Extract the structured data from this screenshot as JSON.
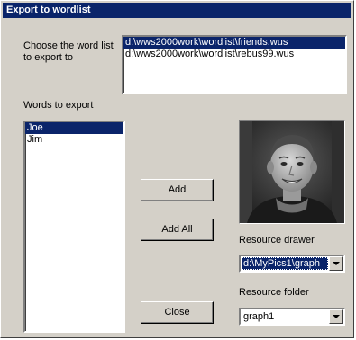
{
  "window": {
    "title": "Export to wordlist"
  },
  "wordlist": {
    "label": "Choose the word list to export to",
    "items": [
      {
        "text": "d:\\wws2000work\\wordlist\\friends.wus",
        "selected": true
      },
      {
        "text": "d:\\wws2000work\\wordlist\\rebus99.wus",
        "selected": false
      }
    ]
  },
  "words": {
    "label": "Words to export",
    "items": [
      {
        "text": "Joe",
        "selected": true
      },
      {
        "text": "Jim",
        "selected": false
      }
    ]
  },
  "buttons": {
    "add": "Add",
    "add_all": "Add All",
    "close": "Close"
  },
  "resource_drawer": {
    "label": "Resource drawer",
    "value": "d:\\MyPics1\\graph"
  },
  "resource_folder": {
    "label": "Resource folder",
    "value": "graph1"
  },
  "icons": {
    "dropdown": "chevron-down-icon"
  },
  "colors": {
    "titlebar": "#0a246a",
    "face": "#d4d0c8",
    "selection": "#0a246a"
  }
}
